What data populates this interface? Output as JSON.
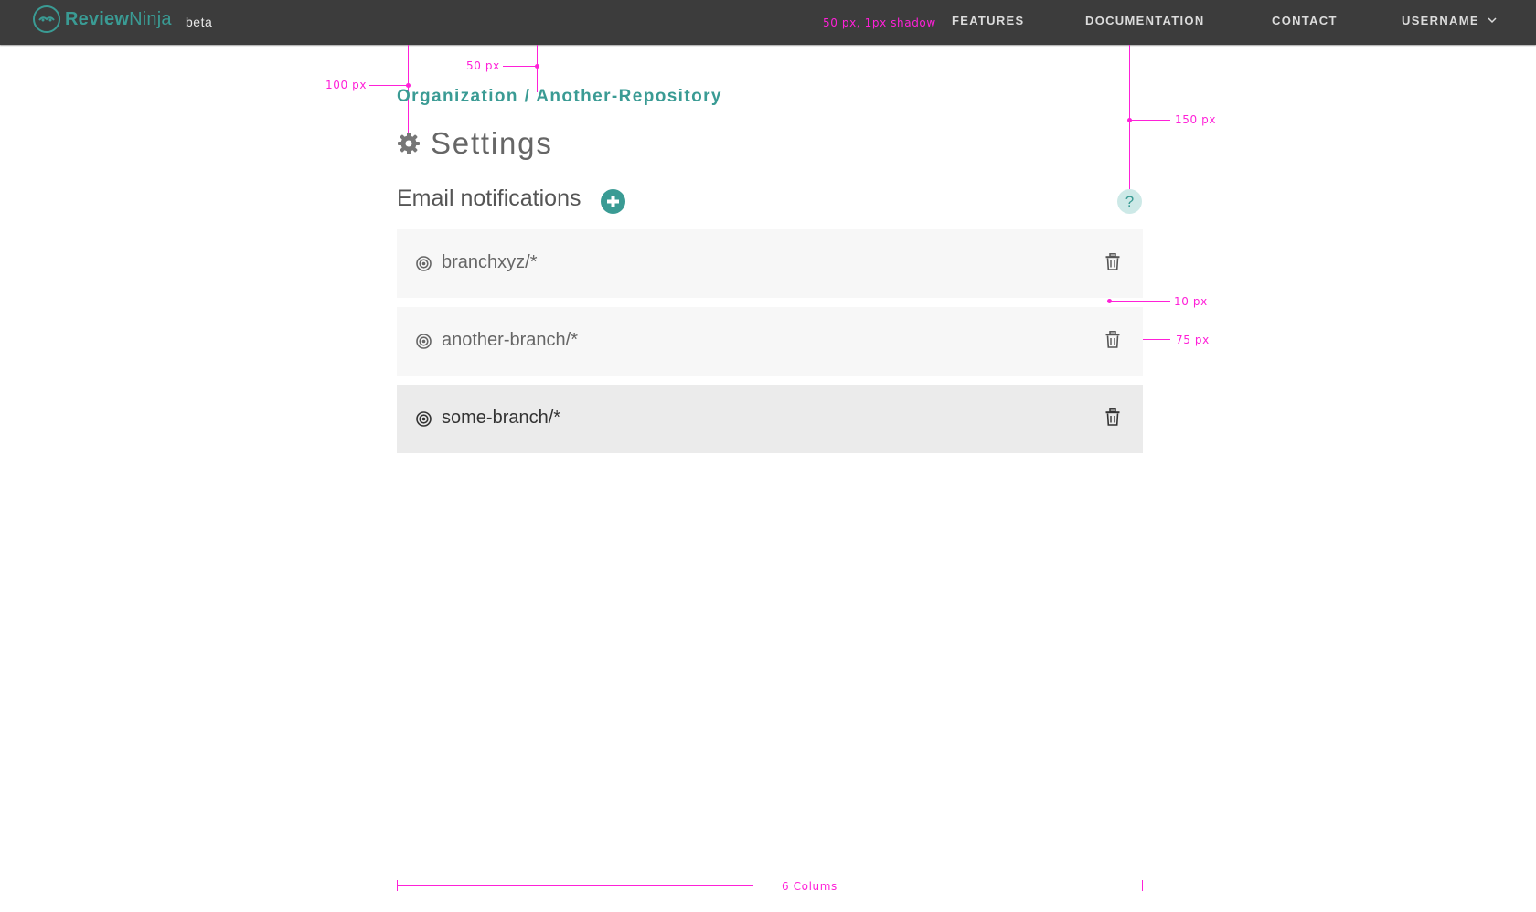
{
  "navbar": {
    "brand_bold": "Review",
    "brand_light": "Ninja",
    "beta": "beta",
    "links": [
      "FEATURES",
      "DOCUMENTATION",
      "CONTACT"
    ],
    "user": "USERNAME"
  },
  "page": {
    "breadcrumb": "Organization / Another-Repository",
    "title": "Settings",
    "section_title": "Email notifications",
    "help_label": "?"
  },
  "notifications": [
    {
      "branch": "branchxyz/*",
      "state": "normal"
    },
    {
      "branch": "another-branch/*",
      "state": "normal"
    },
    {
      "branch": "some-branch/*",
      "state": "active"
    }
  ],
  "annotations": {
    "navbar": "50 px, 1px shadow",
    "left_margin": "100 px",
    "top_gap": "50 px",
    "header_height": "150 px",
    "row_gap": "10 px",
    "row_height": "75 px",
    "columns": "6 Colums"
  },
  "colors": {
    "accent": "#3a9b94",
    "navbar_bg": "#3c3c3c",
    "annotation": "#ff20d8",
    "row_bg": "#f7f7f7",
    "row_active_bg": "#ebebeb"
  },
  "icons": [
    "ninja-logo-icon",
    "chevron-down-icon",
    "gear-icon",
    "plus-icon",
    "help-icon",
    "target-icon",
    "trash-icon"
  ]
}
